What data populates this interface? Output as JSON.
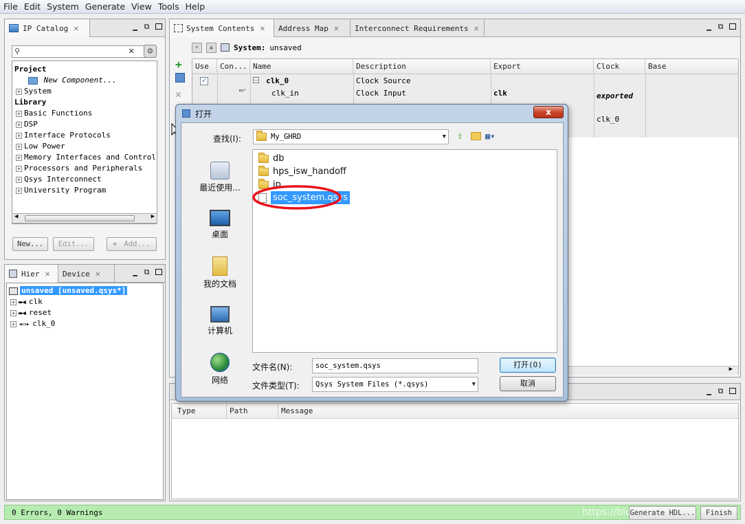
{
  "menubar": {
    "items": [
      "File",
      "Edit",
      "System",
      "Generate",
      "View",
      "Tools",
      "Help"
    ]
  },
  "ip_catalog": {
    "tab_label": "IP Catalog",
    "tree": {
      "project_header": "Project",
      "new_component": "New Component...",
      "system": "System",
      "library_header": "Library",
      "library_items": [
        "Basic Functions",
        "DSP",
        "Interface Protocols",
        "Low Power",
        "Memory Interfaces and Controllers",
        "Processors and Peripherals",
        "Qsys Interconnect",
        "University Program"
      ]
    },
    "buttons": {
      "new": "New...",
      "edit": "Edit...",
      "add": "Add..."
    }
  },
  "hierarchy": {
    "tabs": [
      "Hier",
      "Device"
    ],
    "root": "unsaved [unsaved.qsys*]",
    "items": [
      "clk",
      "reset",
      "clk_0"
    ]
  },
  "system_contents": {
    "tabs": [
      "System Contents",
      "Address Map",
      "Interconnect Requirements"
    ],
    "system_label": "System:",
    "system_value": "unsaved",
    "columns": [
      "Use",
      "Con...",
      "Name",
      "Description",
      "Export",
      "Clock",
      "Base"
    ],
    "rows": [
      {
        "name": "clk_0",
        "description": "Clock Source",
        "export": "",
        "clock": ""
      },
      {
        "name": "clk_in",
        "description": "Clock Input",
        "export": "clk",
        "clock": "exported"
      },
      {
        "name": "",
        "description": "",
        "export": "",
        "clock": "clk_0"
      }
    ]
  },
  "messages": {
    "columns": [
      "Type",
      "Path",
      "Message"
    ]
  },
  "status": {
    "text": "0 Errors, 0 Warnings"
  },
  "bottom_buttons": {
    "generate": "Generate HDL...",
    "finish": "Finish"
  },
  "watermark": "https://blog.csdn.net",
  "dialog": {
    "title": "打开",
    "close_glyph": "x",
    "lookin_label": "查找(I):",
    "lookin_value": "My_GHRD",
    "places": [
      "最近使用...",
      "桌面",
      "我的文档",
      "计算机",
      "网络"
    ],
    "files": [
      {
        "name": "db",
        "type": "folder"
      },
      {
        "name": "hps_isw_handoff",
        "type": "folder"
      },
      {
        "name": "ip",
        "type": "folder"
      },
      {
        "name": "soc_system.qsys",
        "type": "file",
        "selected": true
      }
    ],
    "filename_label": "文件名(N):",
    "filename_value": "soc_system.qsys",
    "filetype_label": "文件类型(T):",
    "filetype_value": "Qsys System Files (*.qsys)",
    "open_button": "打开(O)",
    "cancel_button": "取消",
    "highlight_color": "#e8141b",
    "selection_color": "#3399ff"
  }
}
